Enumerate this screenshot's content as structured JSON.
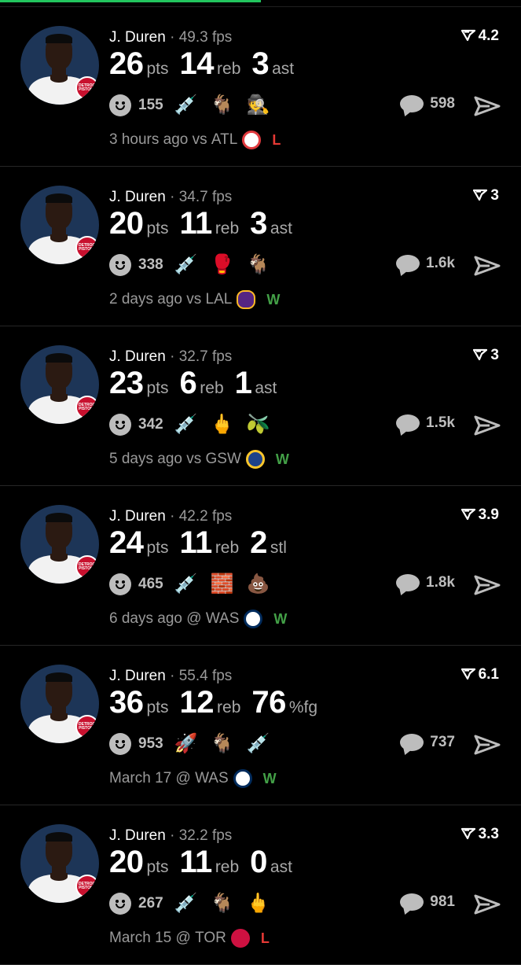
{
  "progress": {
    "fraction": 0.5,
    "color": "#22c55e"
  },
  "colors": {
    "win": "#43a047",
    "loss": "#e53935"
  },
  "posts": [
    {
      "player": "J. Duren",
      "sep": " · ",
      "fps": "49.3 fps",
      "score": "4.2",
      "stats": [
        {
          "num": "26",
          "unit": "pts"
        },
        {
          "num": "14",
          "unit": "reb"
        },
        {
          "num": "3",
          "unit": "ast"
        }
      ],
      "reactions": "155",
      "emojis": [
        "💉",
        "🐐",
        "🕵️"
      ],
      "comments": "598",
      "time": "3 hours ago",
      "vs": "vs",
      "opponent": "ATL",
      "opponent_logo": "hawks-logo",
      "result": "L"
    },
    {
      "player": "J. Duren",
      "sep": " · ",
      "fps": "34.7 fps",
      "score": "3",
      "stats": [
        {
          "num": "20",
          "unit": "pts"
        },
        {
          "num": "11",
          "unit": "reb"
        },
        {
          "num": "3",
          "unit": "ast"
        }
      ],
      "reactions": "338",
      "emojis": [
        "💉",
        "🥊",
        "🐐"
      ],
      "comments": "1.6k",
      "time": "2 days ago",
      "vs": "vs",
      "opponent": "LAL",
      "opponent_logo": "lakers-logo",
      "result": "W"
    },
    {
      "player": "J. Duren",
      "sep": " · ",
      "fps": "32.7 fps",
      "score": "3",
      "stats": [
        {
          "num": "23",
          "unit": "pts"
        },
        {
          "num": "6",
          "unit": "reb"
        },
        {
          "num": "1",
          "unit": "ast"
        }
      ],
      "reactions": "342",
      "emojis": [
        "💉",
        "🖕",
        "🫒"
      ],
      "comments": "1.5k",
      "time": "5 days ago",
      "vs": "vs",
      "opponent": "GSW",
      "opponent_logo": "warriors-logo",
      "result": "W"
    },
    {
      "player": "J. Duren",
      "sep": " · ",
      "fps": "42.2 fps",
      "score": "3.9",
      "stats": [
        {
          "num": "24",
          "unit": "pts"
        },
        {
          "num": "11",
          "unit": "reb"
        },
        {
          "num": "2",
          "unit": "stl"
        }
      ],
      "reactions": "465",
      "emojis": [
        "💉",
        "🧱",
        "💩"
      ],
      "comments": "1.8k",
      "time": "6 days ago",
      "vs": "@",
      "opponent": "WAS",
      "opponent_logo": "wizards-logo",
      "result": "W"
    },
    {
      "player": "J. Duren",
      "sep": " · ",
      "fps": "55.4 fps",
      "score": "6.1",
      "stats": [
        {
          "num": "36",
          "unit": "pts"
        },
        {
          "num": "12",
          "unit": "reb"
        },
        {
          "num": "76",
          "unit": "%fg"
        }
      ],
      "reactions": "953",
      "emojis": [
        "🚀",
        "🐐",
        "💉"
      ],
      "comments": "737",
      "time": "March 17",
      "vs": "@",
      "opponent": "WAS",
      "opponent_logo": "wizards-logo",
      "result": "W"
    },
    {
      "player": "J. Duren",
      "sep": " · ",
      "fps": "32.2 fps",
      "score": "3.3",
      "stats": [
        {
          "num": "20",
          "unit": "pts"
        },
        {
          "num": "11",
          "unit": "reb"
        },
        {
          "num": "0",
          "unit": "ast"
        }
      ],
      "reactions": "267",
      "emojis": [
        "💉",
        "🐐",
        "🖕"
      ],
      "comments": "981",
      "time": "March 15",
      "vs": "@",
      "opponent": "TOR",
      "opponent_logo": "raptors-logo",
      "result": "L"
    }
  ]
}
